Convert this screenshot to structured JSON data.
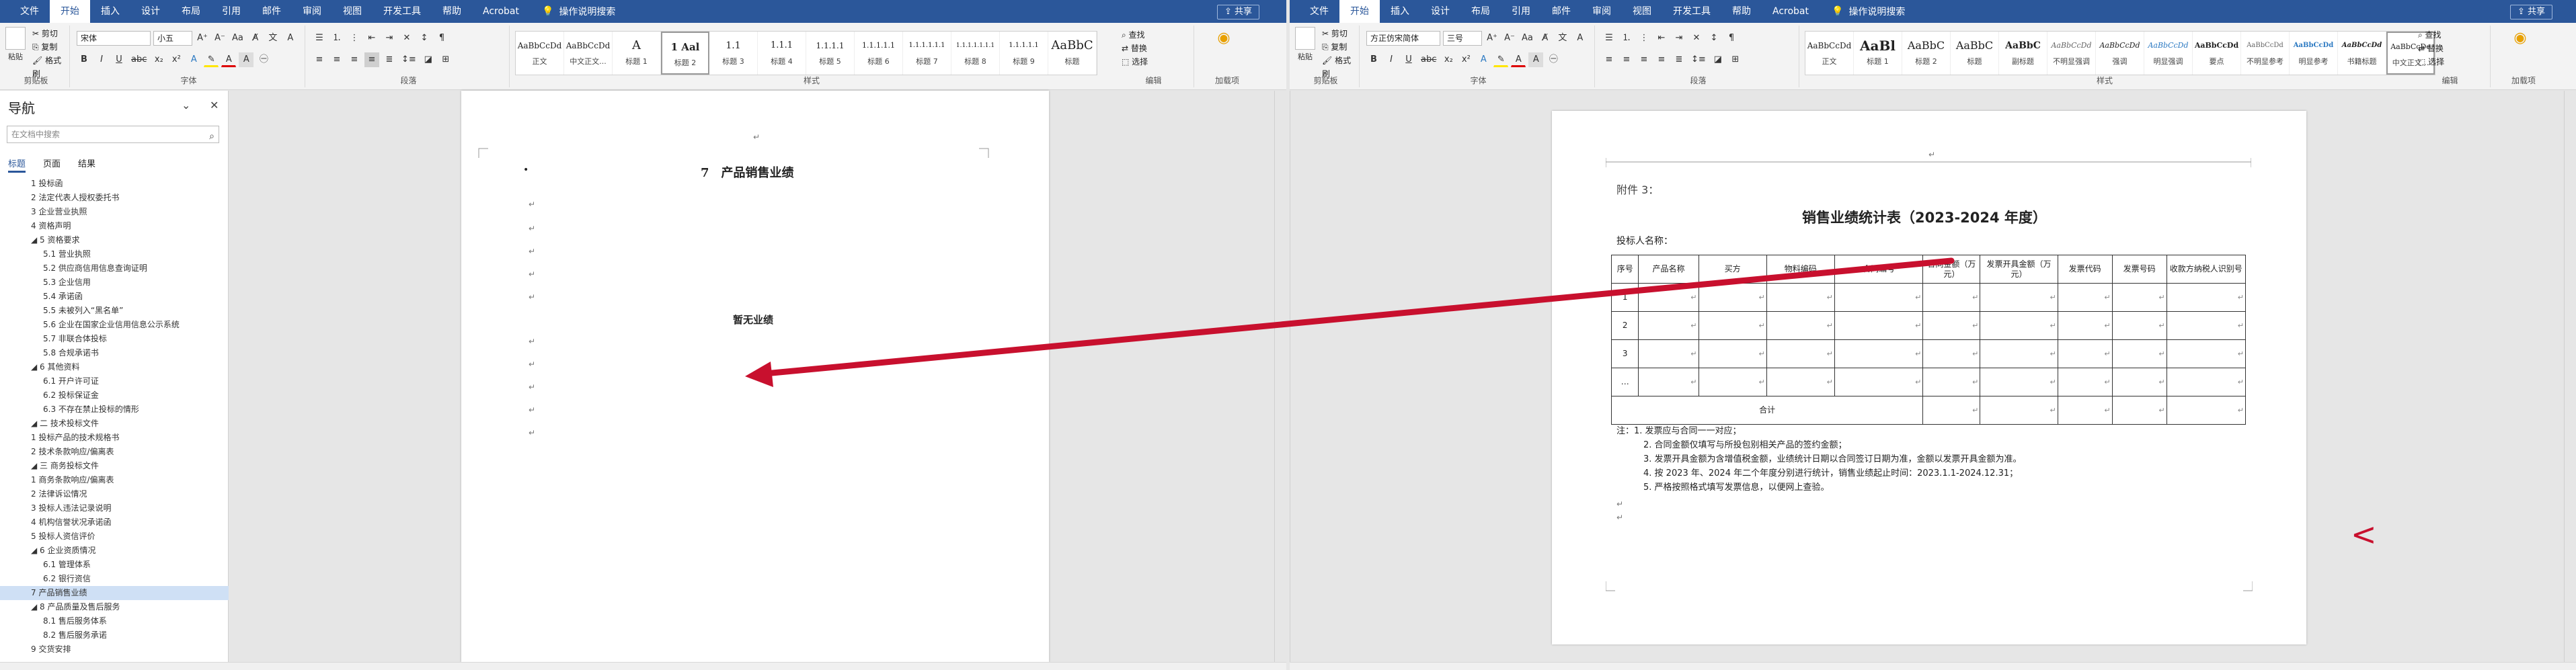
{
  "colors": {
    "accent": "#2b579a",
    "arrow": "#c8102e",
    "selection": "#cfe0f5"
  },
  "left_window": {
    "tabs": [
      "文件",
      "开始",
      "插入",
      "设计",
      "布局",
      "引用",
      "邮件",
      "审阅",
      "视图",
      "开发工具",
      "帮助",
      "Acrobat"
    ],
    "active_tab": "开始",
    "tell_me": "操作说明搜索",
    "share": "共享",
    "clipboard": {
      "paste": "粘贴",
      "cut": "剪切",
      "copy": "复制",
      "format_painter": "格式刷",
      "label": "剪贴板"
    },
    "font": {
      "name": "宋体",
      "size": "小五",
      "label": "字体"
    },
    "paragraph_label": "段落",
    "styles_label": "样式",
    "styles": [
      {
        "preview": "AaBbCcDd",
        "name": "正文"
      },
      {
        "preview": "AaBbCcDd",
        "name": "中文正文..."
      },
      {
        "preview": "A",
        "name": "标题 1"
      },
      {
        "preview": "1 Aal",
        "name": "标题 2"
      },
      {
        "preview": "1.1",
        "name": "标题 3"
      },
      {
        "preview": "1.1.1",
        "name": "标题 4"
      },
      {
        "preview": "1.1.1.1",
        "name": "标题 5"
      },
      {
        "preview": "1.1.1.1.1",
        "name": "标题 6"
      },
      {
        "preview": "1.1.1.1.1.1",
        "name": "标题 7"
      },
      {
        "preview": "1.1.1.1.1.1.1",
        "name": "标题 8"
      },
      {
        "preview": "1.1.1.1.1",
        "name": "标题 9"
      },
      {
        "preview": "AaBbC",
        "name": "标题"
      }
    ],
    "editing": {
      "find": "查找",
      "replace": "替换",
      "select": "选择",
      "label": "编辑"
    },
    "addin": {
      "label": "加载项"
    },
    "nav": {
      "title": "导航",
      "search_placeholder": "在文档中搜索",
      "tabs": [
        "标题",
        "页面",
        "结果"
      ],
      "items": [
        "1 投标函",
        "2 法定代表人授权委托书",
        "3 企业营业执照",
        "4 资格声明",
        "◢ 5 资格要求",
        "5.1 营业执照",
        "5.2 供应商信用信息查询证明",
        "5.3 企业信用",
        "5.4 承诺函",
        "5.5 未被列入“黑名单”",
        "5.6 企业在国家企业信用信息公示系统",
        "5.7 非联合体投标",
        "5.8 合规承诺书",
        "◢ 6 其他资料",
        "6.1 开户许可证",
        "6.2 投标保证金",
        "6.3 不存在禁止投标的情形",
        "◢ 二 技术投标文件",
        "1 投标产品的技术规格书",
        "2 技术条款响应/偏离表",
        "◢ 三 商务投标文件",
        "1 商务条款响应/偏离表",
        "2 法律诉讼情况",
        "3 投标人违法记录说明",
        "4 机构信誉状况承诺函",
        "5 投标人资信评价",
        "◢ 6 企业资质情况",
        "6.1 管理体系",
        "6.2 银行资信",
        "7 产品销售业绩",
        "◢ 8 产品质量及售后服务",
        "8.1 售后服务体系",
        "8.2 售后服务承诺",
        "9 交货安排"
      ],
      "selected_index": 29
    },
    "doc": {
      "heading": "7　产品销售业绩",
      "body": "暂无业绩"
    }
  },
  "right_window": {
    "tabs": [
      "文件",
      "开始",
      "插入",
      "设计",
      "布局",
      "引用",
      "邮件",
      "审阅",
      "视图",
      "开发工具",
      "帮助",
      "Acrobat"
    ],
    "active_tab": "开始",
    "tell_me": "操作说明搜索",
    "share": "共享",
    "clipboard": {
      "paste": "粘贴",
      "cut": "剪切",
      "copy": "复制",
      "format_painter": "格式刷",
      "label": "剪贴板"
    },
    "font": {
      "name": "方正仿宋简体",
      "size": "三号",
      "label": "字体"
    },
    "paragraph_label": "段落",
    "styles_label": "样式",
    "styles": [
      {
        "preview": "AaBbCcDd",
        "name": "正文"
      },
      {
        "preview": "AaBl",
        "name": "标题 1"
      },
      {
        "preview": "AaBbC",
        "name": "标题 2"
      },
      {
        "preview": "AaBbC",
        "name": "标题"
      },
      {
        "preview": "AaBbC",
        "name": "副标题"
      },
      {
        "preview": "AaBbCcDd",
        "name": "不明显强调"
      },
      {
        "preview": "AaBbCcDd",
        "name": "强调"
      },
      {
        "preview": "AaBbCcDd",
        "name": "明显强调"
      },
      {
        "preview": "AaBbCcDd",
        "name": "要点"
      },
      {
        "preview": "AaBbCcDd",
        "name": "不明显参考"
      },
      {
        "preview": "AaBbCcDd",
        "name": "明显参考"
      },
      {
        "preview": "AaBbCcDd",
        "name": "书籍标题"
      },
      {
        "preview": "AaBbCcDe",
        "name": "中文正文..."
      }
    ],
    "editing": {
      "find": "查找",
      "replace": "替换",
      "select": "选择",
      "label": "编辑"
    },
    "addin": {
      "label": "加载项"
    },
    "doc": {
      "attachment": "附件 3：",
      "title": "销售业绩统计表（2023-2024 年度）",
      "bidder_label": "投标人名称：",
      "table_headers": [
        "序号",
        "产品名称",
        "买方",
        "物料编码",
        "合同编号",
        "合同金额（万元）",
        "发票开具金额（万元）",
        "发票代码",
        "发票号码",
        "收款方纳税人识别号"
      ],
      "row_numbers": [
        "1",
        "2",
        "3",
        "…"
      ],
      "total_label": "合计",
      "notes_prefix": "注：",
      "notes": [
        "1. 发票应与合同一一对应；",
        "2. 合同金额仅填写与所投包别相关产品的签约金额；",
        "3. 发票开具金额为含增值税金额，业绩统计日期以合同签订日期为准，金额以发票开具金额为准。",
        "4. 按 2023 年、2024 年二个年度分别进行统计，销售业绩起止时间：2023.1.1-2024.12.31；",
        "5. 严格按照格式填写发票信息，以便网上查验。"
      ],
      "side_mark": "<"
    }
  }
}
